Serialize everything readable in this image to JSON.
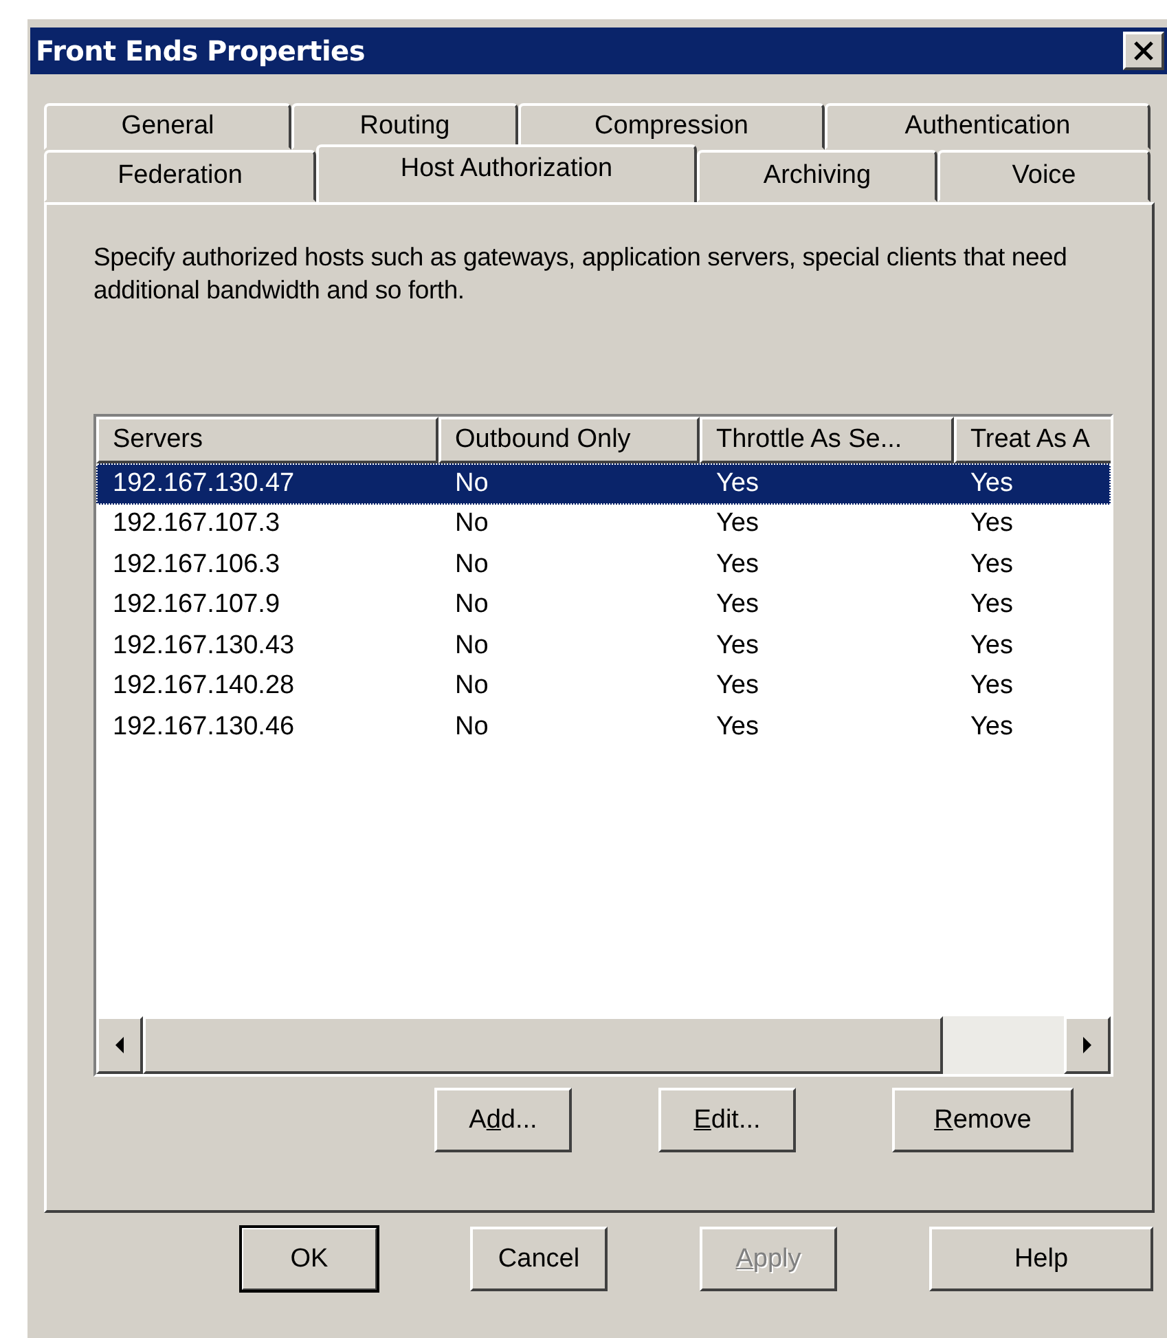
{
  "window": {
    "title": "Front Ends Properties"
  },
  "tab_rows": [
    [
      {
        "label": "General",
        "selected": false
      },
      {
        "label": "Routing",
        "selected": false
      },
      {
        "label": "Compression",
        "selected": false
      },
      {
        "label": "Authentication",
        "selected": false
      }
    ],
    [
      {
        "label": "Federation",
        "selected": false
      },
      {
        "label": "Host Authorization",
        "selected": true
      },
      {
        "label": "Archiving",
        "selected": false
      },
      {
        "label": "Voice",
        "selected": false
      }
    ]
  ],
  "description": "Specify authorized hosts such as gateways, application servers, special clients that need additional bandwidth and so forth.",
  "table": {
    "columns": [
      "Servers",
      "Outbound Only",
      "Throttle As Se...",
      "Treat As A"
    ],
    "rows": [
      {
        "cells": [
          "192.167.130.47",
          "No",
          "Yes",
          "Yes"
        ],
        "selected": true
      },
      {
        "cells": [
          "192.167.107.3",
          "No",
          "Yes",
          "Yes"
        ],
        "selected": false
      },
      {
        "cells": [
          "192.167.106.3",
          "No",
          "Yes",
          "Yes"
        ],
        "selected": false
      },
      {
        "cells": [
          "192.167.107.9",
          "No",
          "Yes",
          "Yes"
        ],
        "selected": false
      },
      {
        "cells": [
          "192.167.130.43",
          "No",
          "Yes",
          "Yes"
        ],
        "selected": false
      },
      {
        "cells": [
          "192.167.140.28",
          "No",
          "Yes",
          "Yes"
        ],
        "selected": false
      },
      {
        "cells": [
          "192.167.130.46",
          "No",
          "Yes",
          "Yes"
        ],
        "selected": false
      }
    ]
  },
  "list_buttons": [
    {
      "label_start": "A",
      "access_key": "d",
      "label_end": "d...",
      "disabled": false
    },
    {
      "access_key": "E",
      "label_end": "dit...",
      "disabled": false
    },
    {
      "access_key": "R",
      "label_end": "emove",
      "disabled": false
    }
  ],
  "dialog_buttons": [
    {
      "label_start": "OK",
      "disabled": false,
      "default": true
    },
    {
      "label_start": "Cancel",
      "disabled": false,
      "default": false
    },
    {
      "access_key": "A",
      "label_end": "pply",
      "disabled": true,
      "default": false
    },
    {
      "label_start": "Help",
      "disabled": false,
      "default": false
    }
  ]
}
